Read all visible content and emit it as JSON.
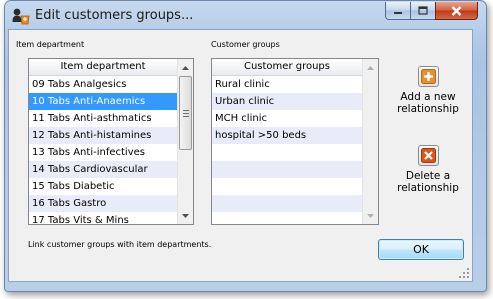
{
  "window": {
    "title": "Edit customers groups...",
    "caption_buttons": [
      "minimize-icon",
      "maximize-icon",
      "close-icon"
    ]
  },
  "left_panel": {
    "section_label": "Item department",
    "column_header": "Item department",
    "selected_index": 1,
    "items": [
      "09 Tabs Analgesics",
      "10 Tabs Anti-Anaemics",
      "11 Tabs Anti-asthmatics",
      "12 Tabs Anti-histamines",
      "13 Tabs Anti-infectives",
      "14 Tabs Cardiovascular",
      "15 Tabs Diabetic",
      "16 Tabs Gastro",
      "17 Tabs Vits & Mins"
    ]
  },
  "right_panel": {
    "section_label": "Customer groups",
    "column_header": "Customer groups",
    "items": [
      "Rural clinic",
      "Urban clinic",
      "MCH clinic",
      "hospital >50 beds"
    ]
  },
  "actions": {
    "add": {
      "label": "Add a new relationship",
      "icon": "plus-icon",
      "icon_color": "#e8902c"
    },
    "delete": {
      "label": "Delete a relationship",
      "icon": "x-icon",
      "icon_color": "#d9571c"
    }
  },
  "footer": {
    "hint": "Link customer groups with item departments.",
    "ok_label": "OK"
  },
  "colors": {
    "selection": "#3399ff",
    "alt_row": "#e8ecf8",
    "frame": "#b6cde9"
  }
}
